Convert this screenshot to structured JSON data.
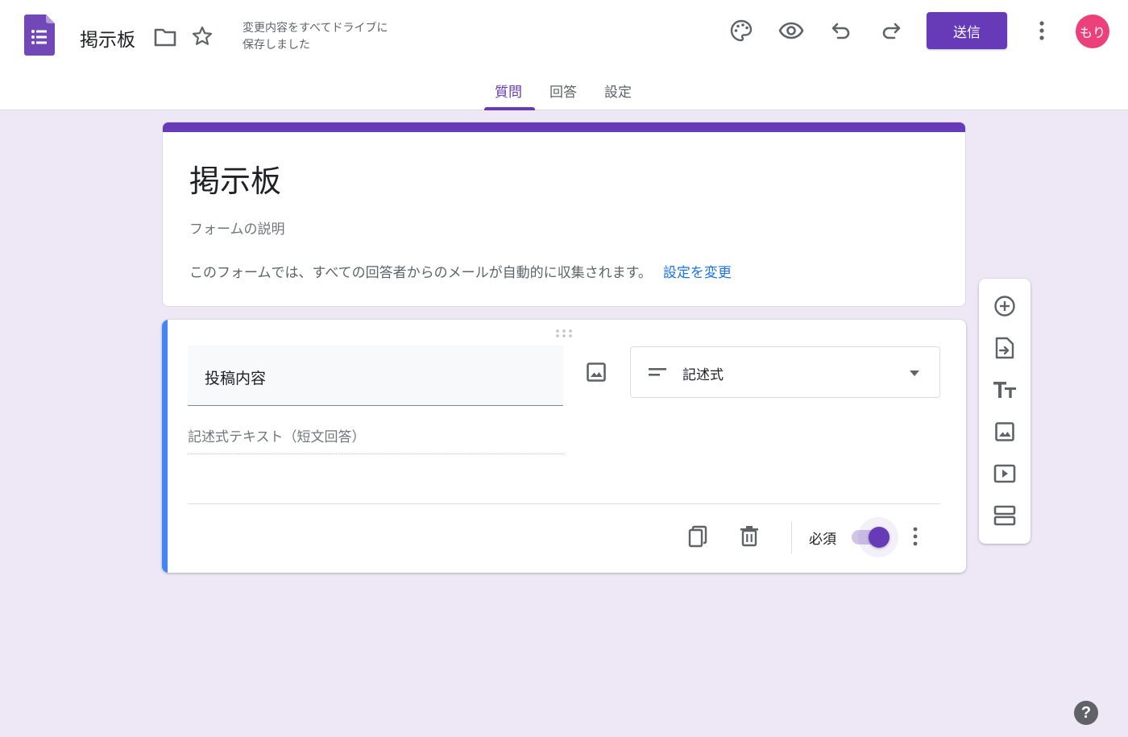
{
  "header": {
    "doc_title": "掲示板",
    "save_status_line1": "変更内容をすべてドライブに",
    "save_status_line2": "保存しました",
    "send_label": "送信",
    "avatar_text": "もり"
  },
  "tabs": [
    {
      "label": "質問",
      "active": true
    },
    {
      "label": "回答",
      "active": false
    },
    {
      "label": "設定",
      "active": false
    }
  ],
  "form": {
    "title": "掲示板",
    "description_placeholder": "フォームの説明",
    "email_notice": "このフォームでは、すべての回答者からのメールが自動的に収集されます。",
    "change_settings_link": "設定を変更"
  },
  "question": {
    "title": "投稿内容",
    "type_label": "記述式",
    "answer_hint": "記述式テキスト（短文回答）",
    "required_label": "必須",
    "required": true
  },
  "help": {
    "label": "?"
  },
  "colors": {
    "accent": "#673ab7",
    "background": "#ede7f6",
    "active_question_bar": "#4285f4",
    "link": "#1a73e8",
    "avatar": "#ec407a"
  },
  "icons": {
    "header": [
      "forms-app-icon",
      "folder-icon",
      "star-icon",
      "palette-icon",
      "preview-eye-icon",
      "undo-icon",
      "redo-icon",
      "more-vert-icon"
    ],
    "side_toolbar": [
      "add-question-icon",
      "import-questions-icon",
      "add-title-icon",
      "add-image-icon",
      "add-video-icon",
      "add-section-icon"
    ]
  }
}
